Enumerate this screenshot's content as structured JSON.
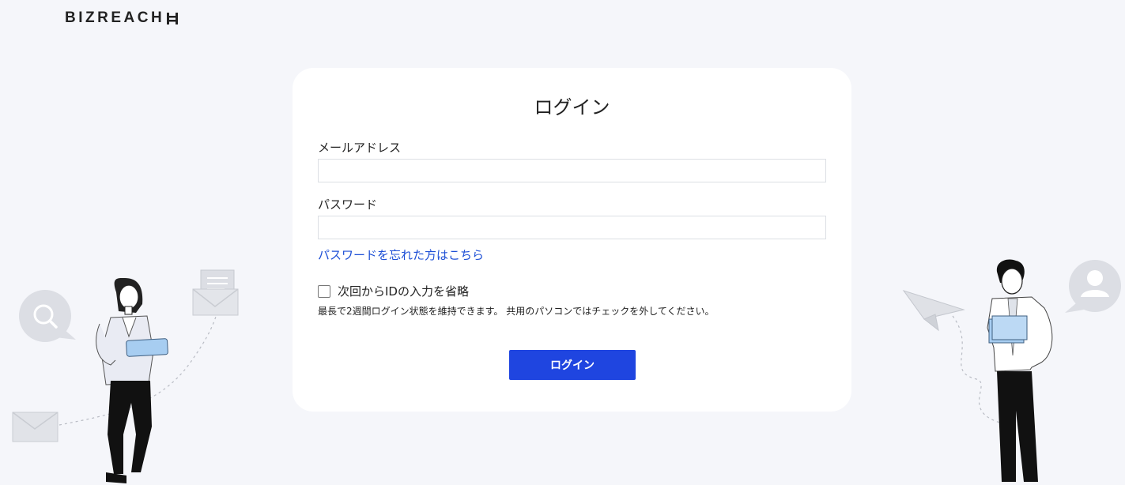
{
  "header": {
    "logo_text": "BIZREACH"
  },
  "login": {
    "title": "ログイン",
    "email_label": "メールアドレス",
    "email_value": "",
    "password_label": "パスワード",
    "password_value": "",
    "forgot_link": "パスワードを忘れた方はこちら",
    "remember_label": "次回からIDの入力を省略",
    "remember_checked": false,
    "remember_note": "最長で2週間ログイン状態を維持できます。 共用のパソコンではチェックを外してください。",
    "submit_label": "ログイン"
  },
  "colors": {
    "background": "#f5f6fa",
    "card": "#ffffff",
    "primary_button": "#1f45e0",
    "link": "#1d4fd6"
  },
  "icons": {
    "left_illustration": [
      "search-icon",
      "mail-icon",
      "envelope-icon",
      "woman-with-tablet"
    ],
    "right_illustration": [
      "paper-plane-icon",
      "user-icon",
      "man-with-folder"
    ]
  }
}
